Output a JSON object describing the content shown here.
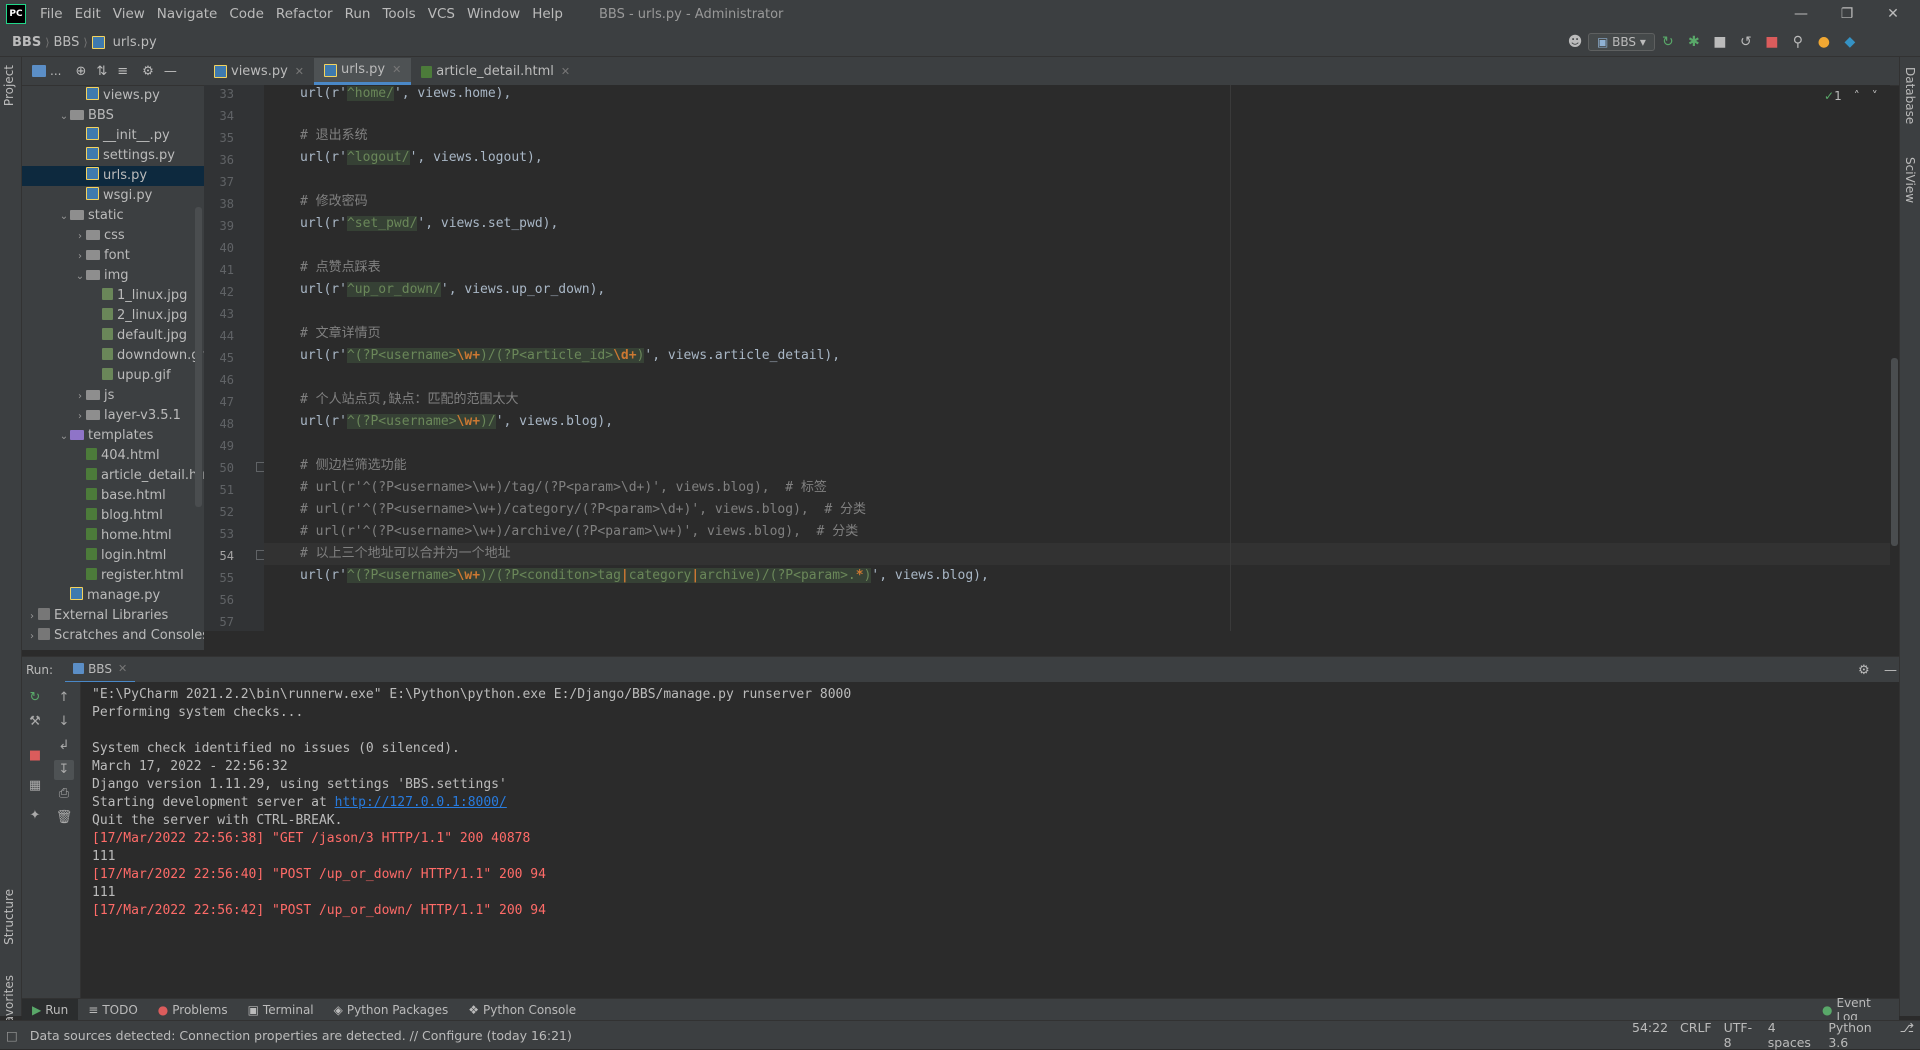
{
  "menubar": {
    "logo": "PC",
    "items": [
      "File",
      "Edit",
      "View",
      "Navigate",
      "Code",
      "Refactor",
      "Run",
      "Tools",
      "VCS",
      "Window",
      "Help"
    ],
    "title": "BBS - urls.py - Administrator"
  },
  "breadcrumbs": [
    "BBS",
    "BBS",
    "urls.py"
  ],
  "run_config": "BBS",
  "project_tree": [
    {
      "label": "views.py",
      "type": "py",
      "indent": 3
    },
    {
      "label": "BBS",
      "type": "folder",
      "indent": 2,
      "open": true
    },
    {
      "label": "__init__.py",
      "type": "py",
      "indent": 3
    },
    {
      "label": "settings.py",
      "type": "py",
      "indent": 3
    },
    {
      "label": "urls.py",
      "type": "py",
      "indent": 3,
      "selected": true
    },
    {
      "label": "wsgi.py",
      "type": "py",
      "indent": 3
    },
    {
      "label": "static",
      "type": "folder",
      "indent": 2,
      "open": true
    },
    {
      "label": "css",
      "type": "folder",
      "indent": 3,
      "closed": true
    },
    {
      "label": "font",
      "type": "folder",
      "indent": 3,
      "closed": true
    },
    {
      "label": "img",
      "type": "folder",
      "indent": 3,
      "open": true
    },
    {
      "label": "1_linux.jpg",
      "type": "img",
      "indent": 4
    },
    {
      "label": "2_linux.jpg",
      "type": "img",
      "indent": 4
    },
    {
      "label": "default.jpg",
      "type": "img",
      "indent": 4
    },
    {
      "label": "downdown.gif",
      "type": "img",
      "indent": 4
    },
    {
      "label": "upup.gif",
      "type": "img",
      "indent": 4
    },
    {
      "label": "js",
      "type": "folder",
      "indent": 3,
      "closed": true
    },
    {
      "label": "layer-v3.5.1",
      "type": "folder",
      "indent": 3,
      "closed": true
    },
    {
      "label": "templates",
      "type": "folder-purple",
      "indent": 2,
      "open": true
    },
    {
      "label": "404.html",
      "type": "html",
      "indent": 3
    },
    {
      "label": "article_detail.html",
      "type": "html",
      "indent": 3
    },
    {
      "label": "base.html",
      "type": "html",
      "indent": 3
    },
    {
      "label": "blog.html",
      "type": "html",
      "indent": 3
    },
    {
      "label": "home.html",
      "type": "html",
      "indent": 3
    },
    {
      "label": "login.html",
      "type": "html",
      "indent": 3
    },
    {
      "label": "register.html",
      "type": "html",
      "indent": 3
    },
    {
      "label": "manage.py",
      "type": "py",
      "indent": 2
    },
    {
      "label": "External Libraries",
      "type": "lib",
      "indent": 0,
      "closed": true
    },
    {
      "label": "Scratches and Consoles",
      "type": "lib",
      "indent": 0,
      "closed": true
    }
  ],
  "project_head_label": "...",
  "editor_tabs": [
    {
      "label": "views.py",
      "type": "py"
    },
    {
      "label": "urls.py",
      "type": "py",
      "active": true
    },
    {
      "label": "article_detail.html",
      "type": "html"
    }
  ],
  "inspection_count": "1",
  "code": {
    "line_numbers": [
      "33",
      "34",
      "35",
      "36",
      "37",
      "38",
      "39",
      "40",
      "41",
      "42",
      "43",
      "44",
      "45",
      "46",
      "47",
      "48",
      "49",
      "50",
      "51",
      "52",
      "53",
      "54",
      "55",
      "56",
      "57"
    ],
    "l33a": "url(r'",
    "l33b": "^home/",
    "l33c": "', views.home),",
    "l35": "# 退出系统",
    "l36a": "url(r'",
    "l36b": "^logout/",
    "l36c": "', views.logout),",
    "l38": "# 修改密码",
    "l39a": "url(r'",
    "l39b": "^set_pwd/",
    "l39c": "', views.set_pwd),",
    "l41": "# 点赞点踩表",
    "l42a": "url(r'",
    "l42b": "^up_or_down/",
    "l42c": "', views.up_or_down),",
    "l44": "# 文章详情页",
    "l45a": "url(r'",
    "l45b": "^(?P<username>",
    "l45c": "\\w+",
    "l45d": ")/(?P<article_id>",
    "l45e": "\\d+",
    "l45f": ")",
    "l45g": "', views.article_detail),",
    "l47": "# 个人站点页,缺点：匹配的范围太大",
    "l48a": "url(r'",
    "l48b": "^(?P<username>",
    "l48c": "\\w+",
    "l48d": ")/",
    "l48e": "', views.blog),",
    "l50": "# 侧边栏筛选功能",
    "l51": "# url(r'^(?P<username>\\w+)/tag/(?P<param>\\d+)', views.blog),  # 标签",
    "l52": "# url(r'^(?P<username>\\w+)/category/(?P<param>\\d+)', views.blog),  # 分类",
    "l53": "# url(r'^(?P<username>\\w+)/archive/(?P<param>\\w+)', views.blog),  # 分类",
    "l54": "# 以上三个地址可以合并为一个地址",
    "l55a": "url(r'",
    "l55b": "^(?P<username>",
    "l55c": "\\w+",
    "l55d": ")/(?P<conditon>tag",
    "l55e": "|",
    "l55f": "category",
    "l55g": "|",
    "l55h": "archive)/(?P<param>.",
    "l55i": "*",
    "l55j": ")",
    "l55k": "', views.blog),"
  },
  "run": {
    "label": "Run:",
    "tab": "BBS",
    "output": [
      {
        "text": "\"E:\\PyCharm 2021.2.2\\bin\\runnerw.exe\" E:\\Python\\python.exe E:/Django/BBS/manage.py runserver 8000",
        "kind": "n"
      },
      {
        "text": "Performing system checks...",
        "kind": "n"
      },
      {
        "text": "",
        "kind": "n"
      },
      {
        "text": "System check identified no issues (0 silenced).",
        "kind": "n"
      },
      {
        "text": "March 17, 2022 - 22:56:32",
        "kind": "n"
      },
      {
        "text": "Django version 1.11.29, using settings 'BBS.settings'",
        "kind": "n"
      },
      {
        "text": "Starting development server at ",
        "kind": "n",
        "link": "http://127.0.0.1:8000/"
      },
      {
        "text": "Quit the server with CTRL-BREAK.",
        "kind": "n"
      },
      {
        "text": "[17/Mar/2022 22:56:38] \"GET /jason/3 HTTP/1.1\" 200 40878",
        "kind": "e"
      },
      {
        "text": "111",
        "kind": "n"
      },
      {
        "text": "[17/Mar/2022 22:56:40] \"POST /up_or_down/ HTTP/1.1\" 200 94",
        "kind": "e"
      },
      {
        "text": "111",
        "kind": "n"
      },
      {
        "text": "[17/Mar/2022 22:56:42] \"POST /up_or_down/ HTTP/1.1\" 200 94",
        "kind": "e"
      }
    ]
  },
  "bottom_tools": [
    "Run",
    "TODO",
    "Problems",
    "Terminal",
    "Python Packages",
    "Python Console"
  ],
  "event_log": "Event Log",
  "side_tabs": {
    "project": "Project",
    "structure": "Structure",
    "favorites": "Favorites",
    "database": "Database",
    "sciview": "SciView"
  },
  "status": {
    "message": "Data sources detected: Connection properties are detected. // Configure (today 16:21)",
    "position": "54:22",
    "line_sep": "CRLF",
    "encoding": "UTF-8",
    "indent": "4 spaces",
    "interpreter": "Python 3.6"
  },
  "colors": {
    "accent": "#4a88c7",
    "error_text": "#ff6b68",
    "link": "#287bde",
    "comment": "#808080",
    "regex": "#6a8759"
  }
}
